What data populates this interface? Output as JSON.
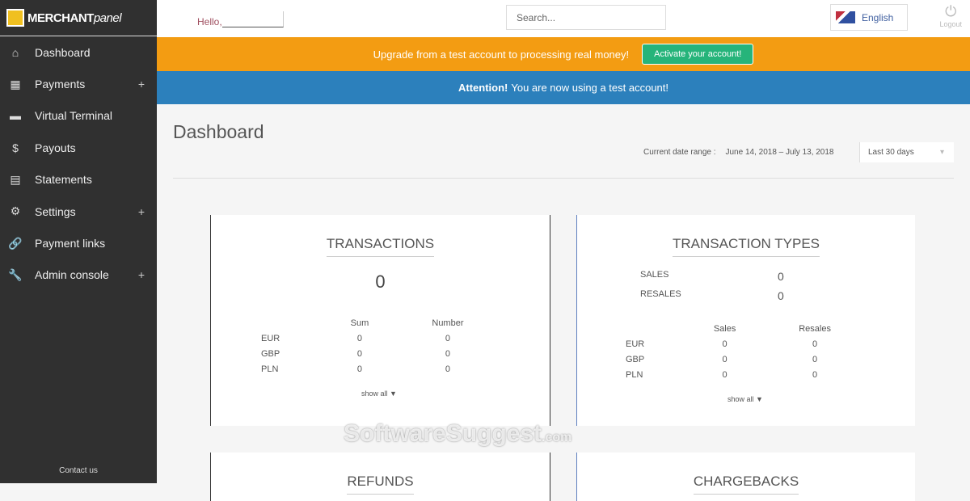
{
  "brand": {
    "bold": "MERCHANT",
    "italic": "panel"
  },
  "sidebar": {
    "items": [
      {
        "label": "Dashboard",
        "icon": "⌂",
        "name": "home",
        "plus": false
      },
      {
        "label": "Payments",
        "icon": "▦",
        "name": "payments",
        "plus": true
      },
      {
        "label": "Virtual Terminal",
        "icon": "▬",
        "name": "card",
        "plus": false
      },
      {
        "label": "Payouts",
        "icon": "$",
        "name": "dollar",
        "plus": false
      },
      {
        "label": "Statements",
        "icon": "▤",
        "name": "statements",
        "plus": false
      },
      {
        "label": "Settings",
        "icon": "⚙",
        "name": "gear",
        "plus": true
      },
      {
        "label": "Payment links",
        "icon": "🔗",
        "name": "link",
        "plus": false
      },
      {
        "label": "Admin console",
        "icon": "🔧",
        "name": "wrench",
        "plus": true
      }
    ],
    "contact": "Contact us",
    "plus": "+"
  },
  "header": {
    "hello": "Hello,",
    "search_placeholder": "Search...",
    "language": "English",
    "logout": "Logout"
  },
  "banner": {
    "upgrade": "Upgrade from a test account to processing real money!",
    "activate": "Activate your account!",
    "attention_bold": "Attention!",
    "attention": "You are now using a test account!"
  },
  "page": {
    "title": "Dashboard",
    "range_label": "Current date range :",
    "range": "June 14, 2018  –  July 13, 2018",
    "range_select": "Last 30 days"
  },
  "transactions": {
    "title": "TRANSACTIONS",
    "total": "0",
    "cols": [
      "Sum",
      "Number"
    ],
    "rows": [
      [
        "EUR",
        "0",
        "0"
      ],
      [
        "GBP",
        "0",
        "0"
      ],
      [
        "PLN",
        "0",
        "0"
      ]
    ],
    "show_all": "show all ▼"
  },
  "types": {
    "title": "TRANSACTION TYPES",
    "summary": [
      [
        "SALES",
        "0"
      ],
      [
        "RESALES",
        "0"
      ]
    ],
    "cols": [
      "Sales",
      "Resales"
    ],
    "rows": [
      [
        "EUR",
        "0",
        "0"
      ],
      [
        "GBP",
        "0",
        "0"
      ],
      [
        "PLN",
        "0",
        "0"
      ]
    ],
    "show_all": "show all ▼"
  },
  "refunds": {
    "title": "REFUNDS"
  },
  "chargebacks": {
    "title": "CHARGEBACKS"
  },
  "watermark": "SoftwareSuggest.com"
}
